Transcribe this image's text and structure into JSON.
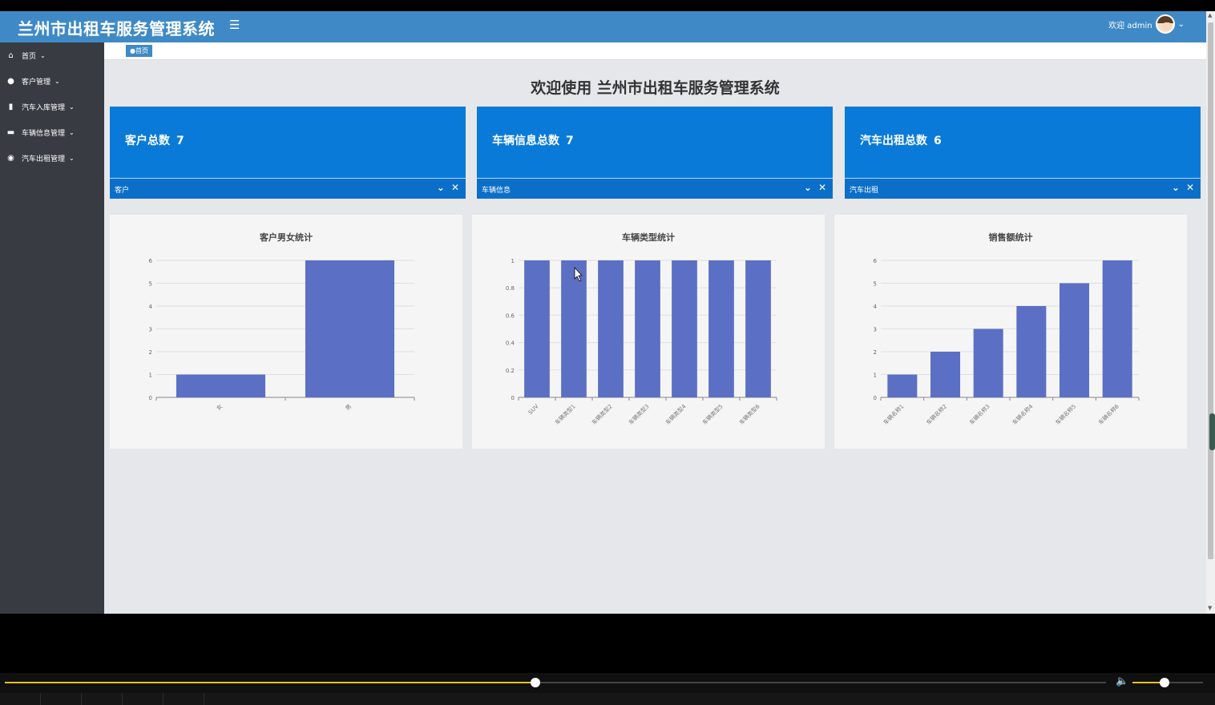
{
  "header": {
    "title": "兰州市出租车服务管理系统",
    "user_greeting": "欢迎 admin"
  },
  "sidebar": {
    "items": [
      {
        "label": "首页"
      },
      {
        "label": "客户管理"
      },
      {
        "label": "汽车入库管理"
      },
      {
        "label": "车辆信息管理"
      },
      {
        "label": "汽车出租管理"
      }
    ]
  },
  "breadcrumb": {
    "label": "●首页"
  },
  "main": {
    "welcome": "欢迎使用 兰州市出租车服务管理系统"
  },
  "cards": [
    {
      "title": "客户总数",
      "count": "7",
      "footer": "客户"
    },
    {
      "title": "车辆信息总数",
      "count": "7",
      "footer": "车辆信息"
    },
    {
      "title": "汽车出租总数",
      "count": "6",
      "footer": "汽车出租"
    }
  ],
  "chart_data": [
    {
      "type": "bar",
      "title": "客户男女统计",
      "categories": [
        "女",
        "男"
      ],
      "values": [
        1,
        6
      ],
      "ylim": [
        0,
        6
      ],
      "yticks": [
        0,
        1,
        2,
        3,
        4,
        5,
        6
      ],
      "grid": true,
      "color": "#5b70c4"
    },
    {
      "type": "bar",
      "title": "车辆类型统计",
      "categories": [
        "SUV",
        "车辆类型1",
        "车辆类型2",
        "车辆类型3",
        "车辆类型4",
        "车辆类型5",
        "车辆类型6"
      ],
      "values": [
        1,
        1,
        1,
        1,
        1,
        1,
        1
      ],
      "ylim": [
        0,
        1
      ],
      "yticks": [
        0,
        0.2,
        0.4,
        0.6,
        0.8,
        1
      ],
      "grid": true,
      "color": "#5b70c4"
    },
    {
      "type": "bar",
      "title": "销售额统计",
      "categories": [
        "车辆名称1",
        "车辆名称2",
        "车辆名称3",
        "车辆名称4",
        "车辆名称5",
        "车辆名称6"
      ],
      "values": [
        1,
        2,
        3,
        4,
        5,
        6
      ],
      "ylim": [
        0,
        6
      ],
      "yticks": [
        0,
        1,
        2,
        3,
        4,
        5,
        6
      ],
      "grid": true,
      "color": "#5b70c4"
    }
  ],
  "player": {
    "progress": 0.482,
    "volume": 0.45
  },
  "colors": {
    "header": "#3f8ac6",
    "sidebar": "#383c42",
    "card": "#097ad8",
    "bar": "#5b70c4",
    "progress": "#e8c21a"
  },
  "icons": [
    "menu-icon",
    "home-icon",
    "user-icon",
    "columns-icon",
    "id-card-icon",
    "circle-icon",
    "chevron-down-icon",
    "close-icon",
    "cursor-icon",
    "volume-icon"
  ]
}
